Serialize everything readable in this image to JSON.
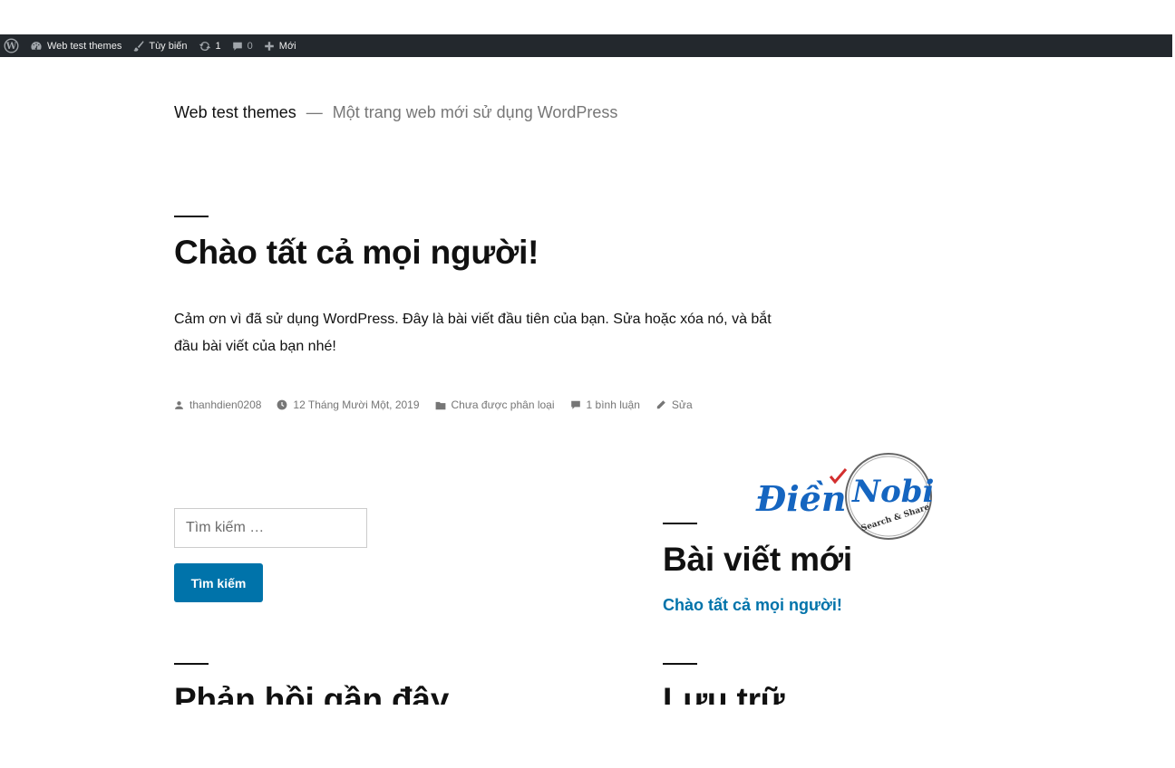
{
  "admin_bar": {
    "site_name": "Web test themes",
    "customize_label": "Tùy biến",
    "updates_count": "1",
    "comments_count": "0",
    "new_label": "Mới"
  },
  "site": {
    "title": "Web test themes",
    "separator": "—",
    "description": "Một trang web mới sử dụng WordPress"
  },
  "post": {
    "title": "Chào tất cả mọi người!",
    "content_line1": "Cảm ơn vì đã sử dụng WordPress. Đây là bài viết đầu tiên của bạn. Sửa hoặc xóa nó, và bắt",
    "content_line2": "đầu bài viết của bạn nhé!",
    "meta": {
      "author": "thanhdien0208",
      "date": "12 Tháng Mười Một, 2019",
      "category": "Chưa được phân loại",
      "comments": "1 bình luận",
      "edit": "Sửa"
    }
  },
  "search": {
    "placeholder": "Tìm kiếm …",
    "button_label": "Tìm kiếm"
  },
  "widgets": {
    "recent_posts_title": "Bài viết mới",
    "recent_post_item": "Chào tất cả mọi người!",
    "recent_comments_title": "Phản hồi gần đây",
    "archives_title": "Lưu trữ"
  },
  "logo": {
    "word1": "Điền",
    "word2": "Nobi",
    "tagline": "Search & Share"
  },
  "colors": {
    "admin_bar_bg": "#23282d",
    "accent": "#0073aa",
    "meta_gray": "#767676"
  }
}
